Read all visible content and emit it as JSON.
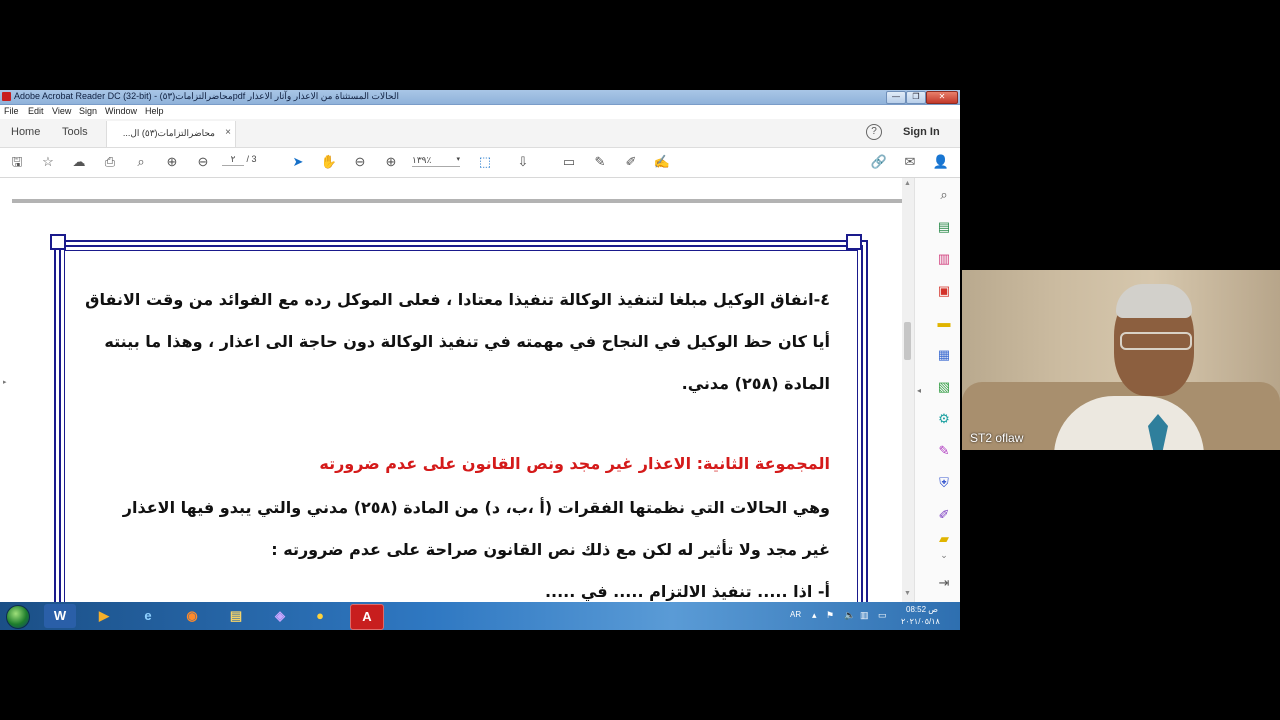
{
  "window": {
    "title": "Adobe Acrobat Reader DC (32-bit) - محاضرالتزامات(٥٣)pdf الحالات المستثناة من الاعذار وآثار الاعذار",
    "min_glyph": "—",
    "max_glyph": "❐",
    "close_glyph": "✕"
  },
  "menu": [
    "File",
    "Edit",
    "View",
    "Sign",
    "Window",
    "Help"
  ],
  "tabs": {
    "home": "Home",
    "tools": "Tools",
    "document": "محاضرالتزامات(٥٣) ال...",
    "close": "×",
    "help": "?",
    "signin": "Sign In"
  },
  "toolbar": {
    "page_current": "٢",
    "page_total": "/ 3",
    "zoom": "١٣٩٪",
    "zoom_arrow": "▾"
  },
  "document_lines": [
    "٤-انفاق الوكيل مبلغا لتنفيذ الوكالة تنفيذا معتادا ،  فعلى الموكل رده مع الفوائد من وقت الانفاق",
    "أيا كان حظ الوكيل في النجاح في مهمته في تنفيذ الوكالة دون حاجة الى اعذار ، وهذا ما بينته",
    "المادة (٢٥٨) مدني.",
    "المجموعة الثانية: الاعذار غير مجد ونص القانون على عدم ضرورته",
    "وهي الحالات التي نظمتها الفقرات (أ ،ب، د) من المادة (٢٥٨) مدني والتي يبدو فيها الاعذار",
    "غير مجد ولا تأثير له لكن مع ذلك نص القانون صراحة على عدم ضرورته :",
    "أ- اذا ..... تنفيذ الالتزام ..... في ....."
  ],
  "taskbar": {
    "lang": "AR",
    "time": "ص 08:52",
    "date": "٢٠٢١/٠٥/١٨",
    "apps": [
      "W",
      "▶",
      "e",
      "◉",
      "▤",
      "◈",
      "●",
      "A"
    ]
  },
  "webcam": {
    "name": "ST2 oflaw"
  },
  "colors": {
    "frame": "#1a1a8c",
    "heading_red": "#d41a1a",
    "acrobat_red": "#c81e1e",
    "select_blue": "#1670c8"
  }
}
